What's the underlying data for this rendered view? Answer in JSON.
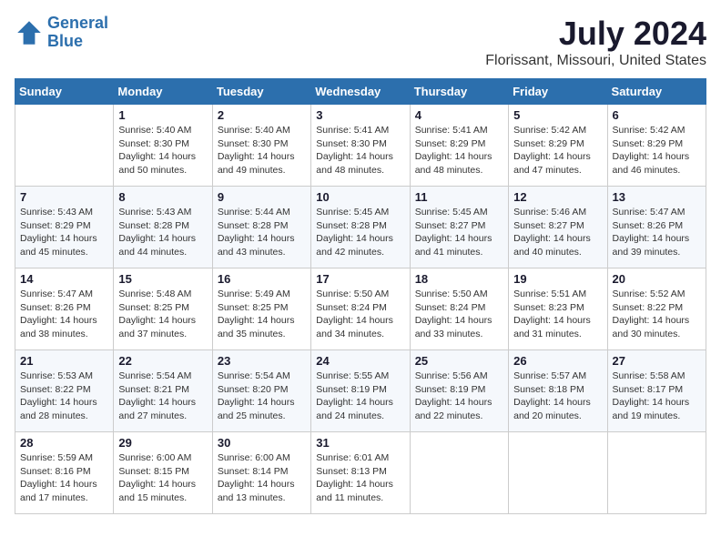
{
  "header": {
    "logo_line1": "General",
    "logo_line2": "Blue",
    "month_year": "July 2024",
    "location": "Florissant, Missouri, United States"
  },
  "days_of_week": [
    "Sunday",
    "Monday",
    "Tuesday",
    "Wednesday",
    "Thursday",
    "Friday",
    "Saturday"
  ],
  "weeks": [
    [
      {
        "day": "",
        "info": ""
      },
      {
        "day": "1",
        "info": "Sunrise: 5:40 AM\nSunset: 8:30 PM\nDaylight: 14 hours\nand 50 minutes."
      },
      {
        "day": "2",
        "info": "Sunrise: 5:40 AM\nSunset: 8:30 PM\nDaylight: 14 hours\nand 49 minutes."
      },
      {
        "day": "3",
        "info": "Sunrise: 5:41 AM\nSunset: 8:30 PM\nDaylight: 14 hours\nand 48 minutes."
      },
      {
        "day": "4",
        "info": "Sunrise: 5:41 AM\nSunset: 8:29 PM\nDaylight: 14 hours\nand 48 minutes."
      },
      {
        "day": "5",
        "info": "Sunrise: 5:42 AM\nSunset: 8:29 PM\nDaylight: 14 hours\nand 47 minutes."
      },
      {
        "day": "6",
        "info": "Sunrise: 5:42 AM\nSunset: 8:29 PM\nDaylight: 14 hours\nand 46 minutes."
      }
    ],
    [
      {
        "day": "7",
        "info": "Sunrise: 5:43 AM\nSunset: 8:29 PM\nDaylight: 14 hours\nand 45 minutes."
      },
      {
        "day": "8",
        "info": "Sunrise: 5:43 AM\nSunset: 8:28 PM\nDaylight: 14 hours\nand 44 minutes."
      },
      {
        "day": "9",
        "info": "Sunrise: 5:44 AM\nSunset: 8:28 PM\nDaylight: 14 hours\nand 43 minutes."
      },
      {
        "day": "10",
        "info": "Sunrise: 5:45 AM\nSunset: 8:28 PM\nDaylight: 14 hours\nand 42 minutes."
      },
      {
        "day": "11",
        "info": "Sunrise: 5:45 AM\nSunset: 8:27 PM\nDaylight: 14 hours\nand 41 minutes."
      },
      {
        "day": "12",
        "info": "Sunrise: 5:46 AM\nSunset: 8:27 PM\nDaylight: 14 hours\nand 40 minutes."
      },
      {
        "day": "13",
        "info": "Sunrise: 5:47 AM\nSunset: 8:26 PM\nDaylight: 14 hours\nand 39 minutes."
      }
    ],
    [
      {
        "day": "14",
        "info": "Sunrise: 5:47 AM\nSunset: 8:26 PM\nDaylight: 14 hours\nand 38 minutes."
      },
      {
        "day": "15",
        "info": "Sunrise: 5:48 AM\nSunset: 8:25 PM\nDaylight: 14 hours\nand 37 minutes."
      },
      {
        "day": "16",
        "info": "Sunrise: 5:49 AM\nSunset: 8:25 PM\nDaylight: 14 hours\nand 35 minutes."
      },
      {
        "day": "17",
        "info": "Sunrise: 5:50 AM\nSunset: 8:24 PM\nDaylight: 14 hours\nand 34 minutes."
      },
      {
        "day": "18",
        "info": "Sunrise: 5:50 AM\nSunset: 8:24 PM\nDaylight: 14 hours\nand 33 minutes."
      },
      {
        "day": "19",
        "info": "Sunrise: 5:51 AM\nSunset: 8:23 PM\nDaylight: 14 hours\nand 31 minutes."
      },
      {
        "day": "20",
        "info": "Sunrise: 5:52 AM\nSunset: 8:22 PM\nDaylight: 14 hours\nand 30 minutes."
      }
    ],
    [
      {
        "day": "21",
        "info": "Sunrise: 5:53 AM\nSunset: 8:22 PM\nDaylight: 14 hours\nand 28 minutes."
      },
      {
        "day": "22",
        "info": "Sunrise: 5:54 AM\nSunset: 8:21 PM\nDaylight: 14 hours\nand 27 minutes."
      },
      {
        "day": "23",
        "info": "Sunrise: 5:54 AM\nSunset: 8:20 PM\nDaylight: 14 hours\nand 25 minutes."
      },
      {
        "day": "24",
        "info": "Sunrise: 5:55 AM\nSunset: 8:19 PM\nDaylight: 14 hours\nand 24 minutes."
      },
      {
        "day": "25",
        "info": "Sunrise: 5:56 AM\nSunset: 8:19 PM\nDaylight: 14 hours\nand 22 minutes."
      },
      {
        "day": "26",
        "info": "Sunrise: 5:57 AM\nSunset: 8:18 PM\nDaylight: 14 hours\nand 20 minutes."
      },
      {
        "day": "27",
        "info": "Sunrise: 5:58 AM\nSunset: 8:17 PM\nDaylight: 14 hours\nand 19 minutes."
      }
    ],
    [
      {
        "day": "28",
        "info": "Sunrise: 5:59 AM\nSunset: 8:16 PM\nDaylight: 14 hours\nand 17 minutes."
      },
      {
        "day": "29",
        "info": "Sunrise: 6:00 AM\nSunset: 8:15 PM\nDaylight: 14 hours\nand 15 minutes."
      },
      {
        "day": "30",
        "info": "Sunrise: 6:00 AM\nSunset: 8:14 PM\nDaylight: 14 hours\nand 13 minutes."
      },
      {
        "day": "31",
        "info": "Sunrise: 6:01 AM\nSunset: 8:13 PM\nDaylight: 14 hours\nand 11 minutes."
      },
      {
        "day": "",
        "info": ""
      },
      {
        "day": "",
        "info": ""
      },
      {
        "day": "",
        "info": ""
      }
    ]
  ]
}
